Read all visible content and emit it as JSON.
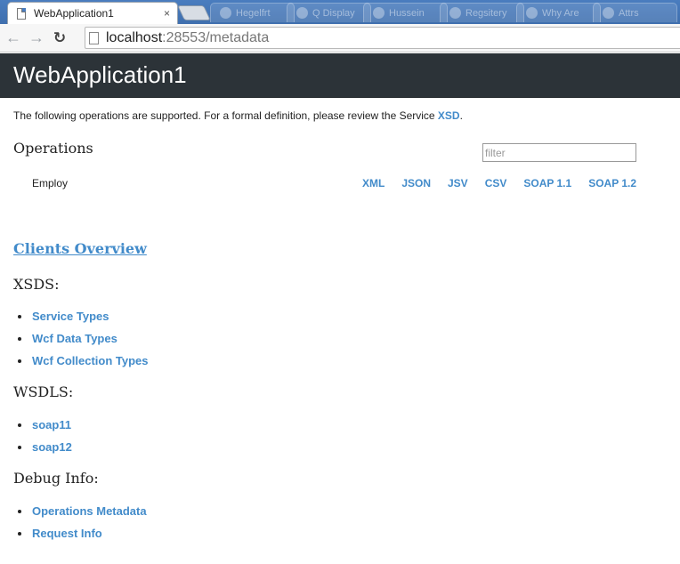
{
  "browser": {
    "tab_title": "WebApplication1",
    "tab_close": "×",
    "background_tabs": [
      "Hegelfrt",
      "Q Display",
      "Hussein",
      "Regsitery",
      "Why Are",
      "Attrs"
    ],
    "url_host": "localhost",
    "url_rest": ":28553/metadata"
  },
  "header": {
    "title": "WebApplication1"
  },
  "intro": {
    "text": "The following operations are supported. For a formal definition, please review the Service ",
    "link": "XSD",
    "end": "."
  },
  "operations": {
    "heading": "Operations",
    "filter_placeholder": "filter",
    "rows": [
      {
        "name": "Employ",
        "formats": [
          "XML",
          "JSON",
          "JSV",
          "CSV",
          "SOAP 1.1",
          "SOAP 1.2"
        ]
      }
    ]
  },
  "clients_overview": "Clients Overview",
  "xsds": {
    "heading": "XSDS:",
    "links": [
      "Service Types",
      "Wcf Data Types",
      "Wcf Collection Types"
    ]
  },
  "wsdls": {
    "heading": "WSDLS:",
    "links": [
      "soap11",
      "soap12"
    ]
  },
  "debug": {
    "heading": "Debug Info:",
    "links": [
      "Operations Metadata",
      "Request Info"
    ]
  },
  "colors": {
    "header_bg": "#2c3338",
    "link": "#428bca",
    "tabstrip": "#4a7dbf"
  }
}
